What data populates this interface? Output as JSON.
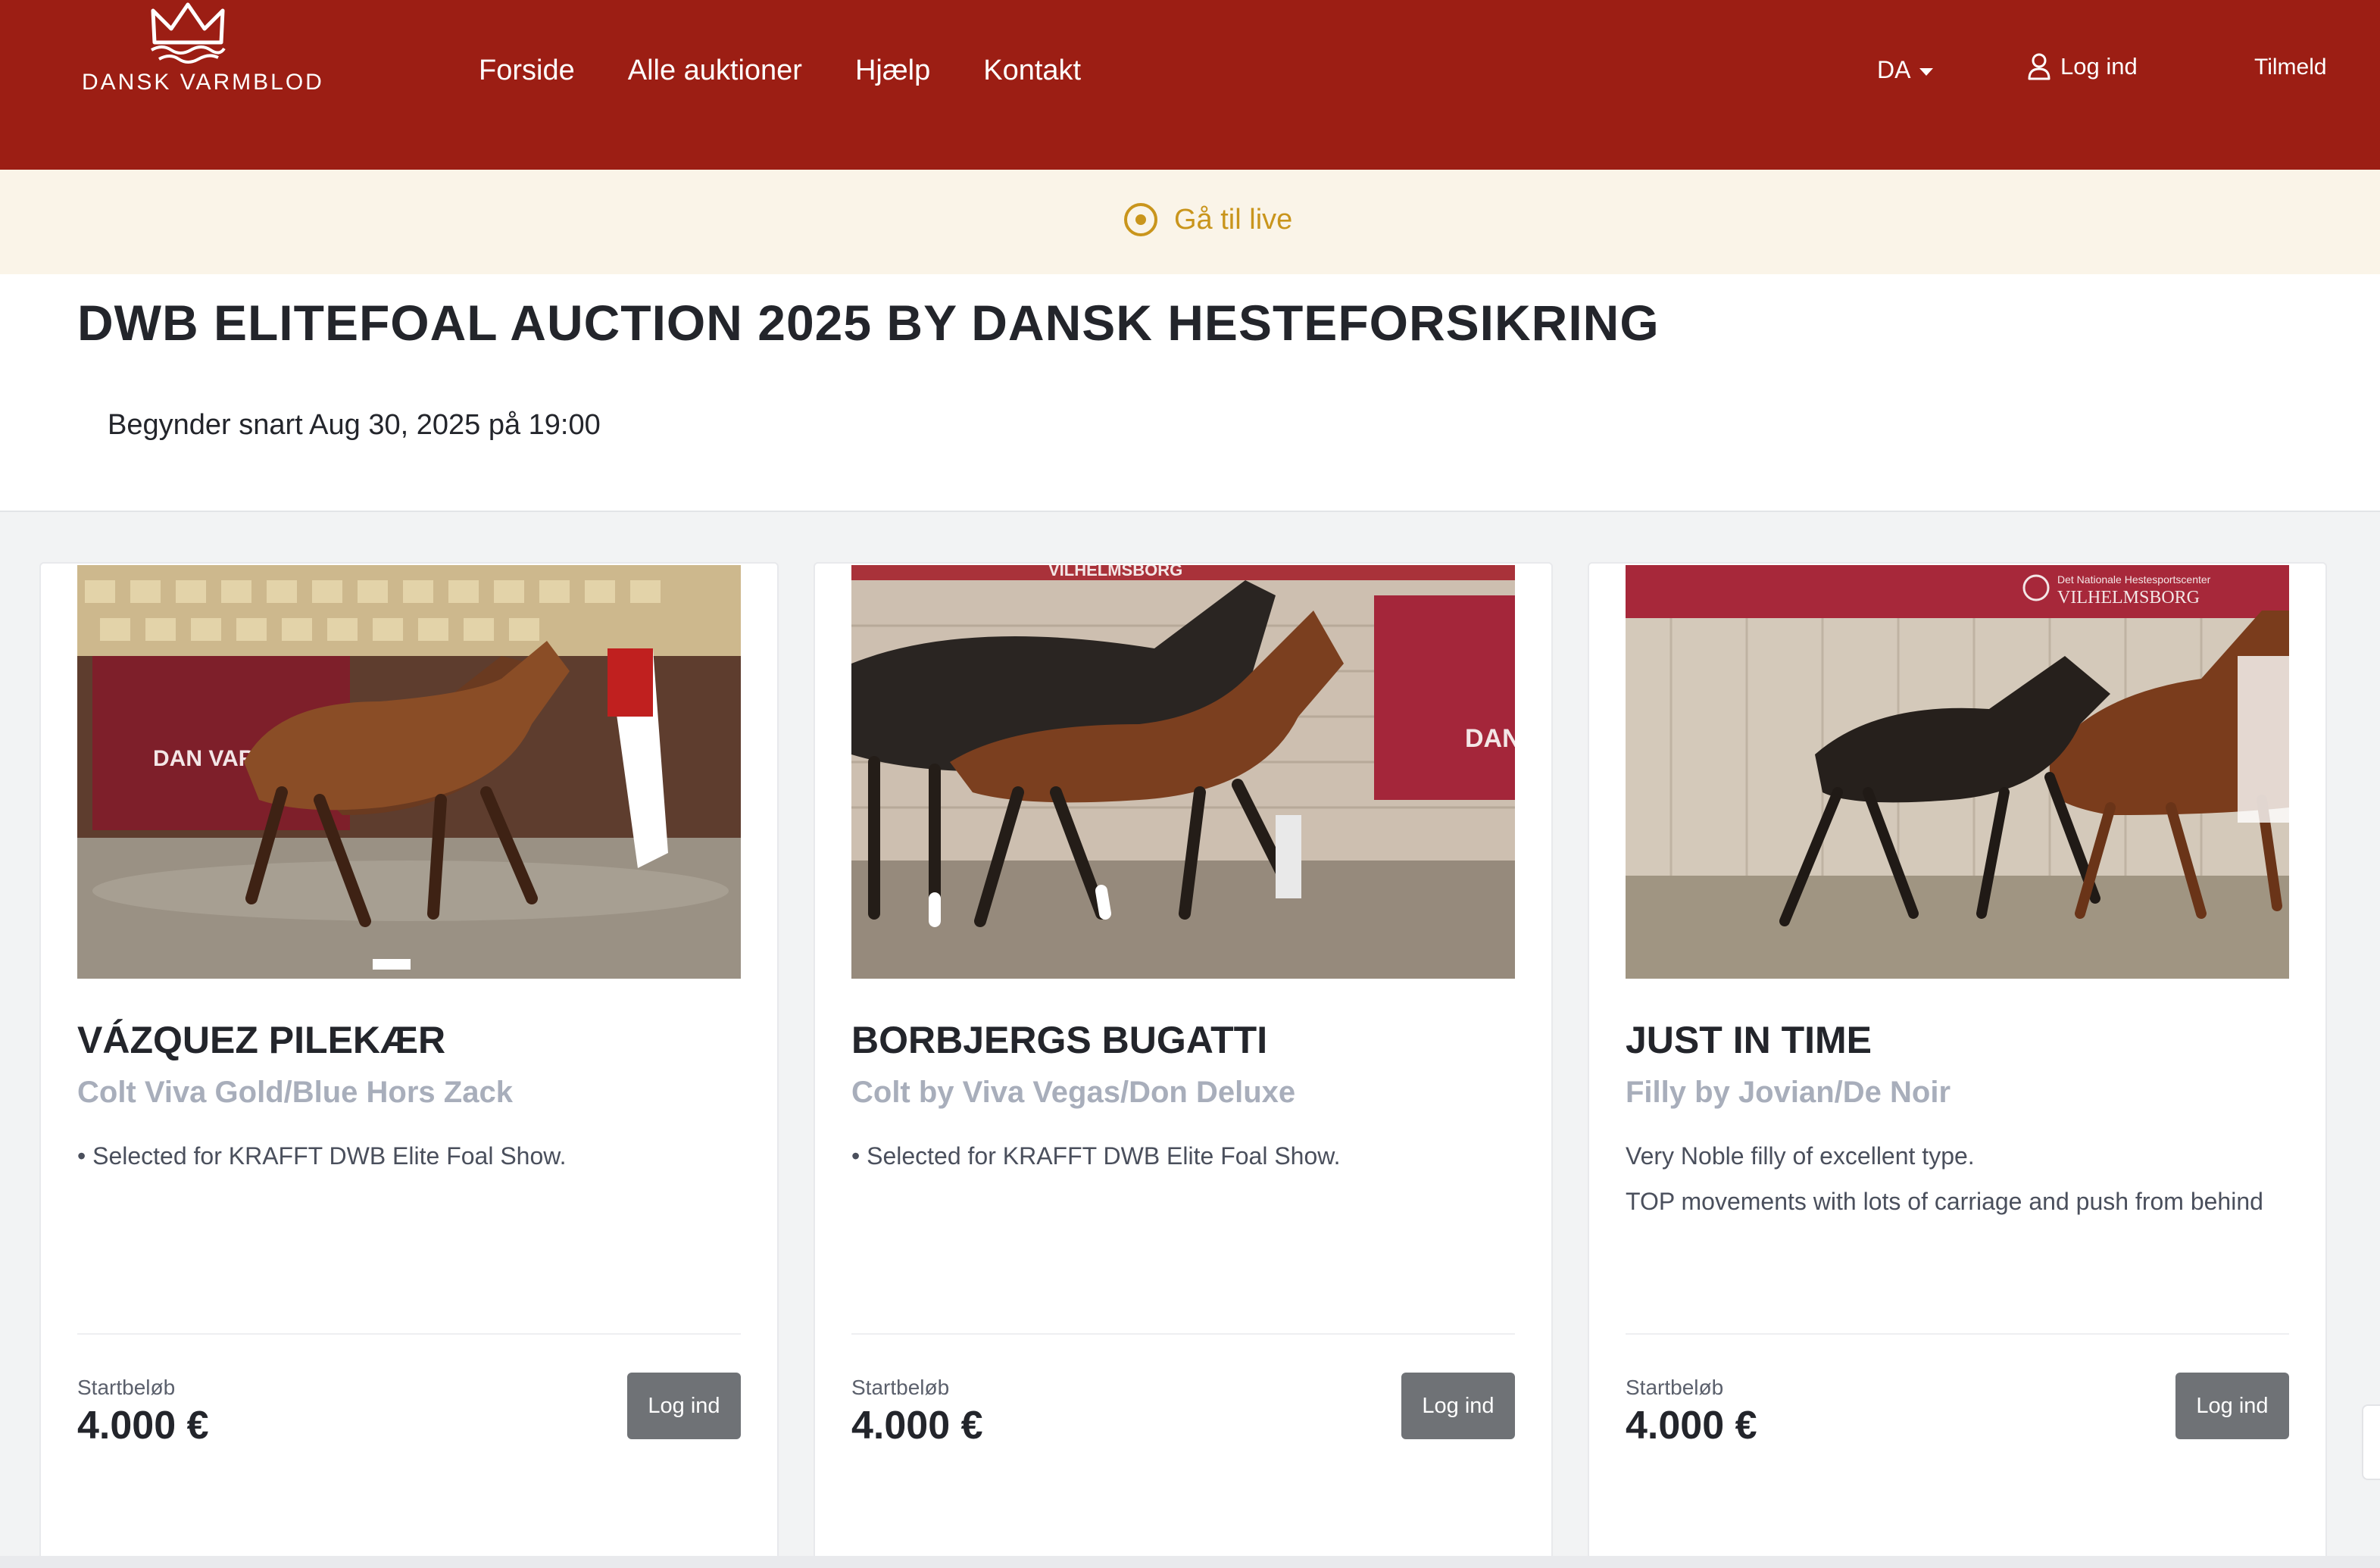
{
  "header": {
    "logo_text": "DANSK VARMBLOD",
    "nav": [
      "Forside",
      "Alle auktioner",
      "Hjælp",
      "Kontakt"
    ],
    "language": "DA",
    "login_label": "Log ind",
    "signup_label": "Tilmeld"
  },
  "livebar": {
    "label": "Gå til live"
  },
  "auction": {
    "title": "DWB ELITEFOAL AUCTION 2025 BY DANSK HESTEFORSIKRING",
    "start_info": "Begynder snart Aug 30, 2025 på 19:00"
  },
  "lots": [
    {
      "name": "VÁZQUEZ PILEKÆR",
      "subtitle": "Colt Viva Gold/Blue Hors Zack",
      "description": [
        "• Selected for KRAFFT DWB Elite Foal Show."
      ],
      "price_label": "Startbeløb",
      "price": "4.000 €",
      "button": "Log ind",
      "image_text": "DAN   VAR"
    },
    {
      "name": "BORBJERGS BUGATTI",
      "subtitle": "Colt by Viva Vegas/Don Deluxe",
      "description": [
        "• Selected for KRAFFT DWB Elite Foal Show."
      ],
      "price_label": "Startbeløb",
      "price": "4.000 €",
      "button": "Log ind",
      "image_text": "VILHELMSBORG",
      "image_text2": "DAN"
    },
    {
      "name": "JUST IN TIME",
      "subtitle": "Filly by Jovian/De Noir",
      "description": [
        "Very Noble filly of excellent type.",
        "TOP movements with lots of carriage and push from behind"
      ],
      "price_label": "Startbeløb",
      "price": "4.000 €",
      "button": "Log ind",
      "image_text": "Det Nationale Hestesportscenter",
      "image_text2": "VILHELMSBORG"
    }
  ],
  "colors": {
    "header": "#9c1e14",
    "live": "#c9951c",
    "button": "#6f7276"
  }
}
